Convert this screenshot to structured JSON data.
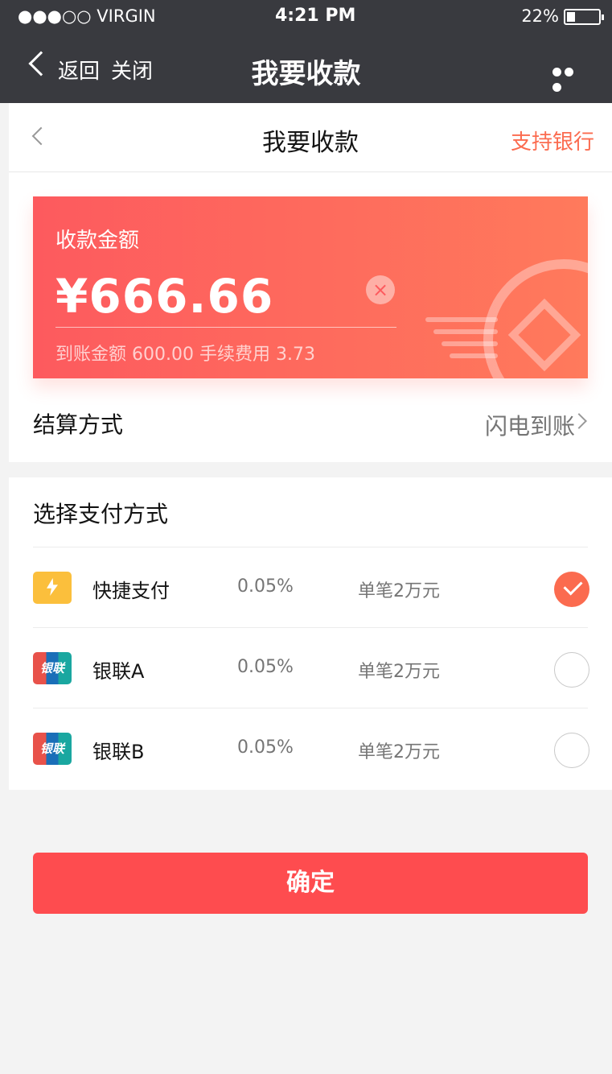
{
  "status_bar": {
    "carrier": "●●●○○ VIRGIN",
    "time": "4:21 PM",
    "battery": "22%"
  },
  "wechat_bar": {
    "back_label": "返回",
    "close_label": "关闭",
    "title": "我要收款"
  },
  "header": {
    "title": "我要收款",
    "right_link": "支持银行"
  },
  "amount_card": {
    "label": "收款金额",
    "amount": "¥666.66",
    "received_text": "到账金额 600.00 手续费用 3.73",
    "clear_icon": "×"
  },
  "settlement": {
    "label": "结算方式",
    "value": "闪电到账"
  },
  "payment": {
    "title": "选择支付方式",
    "methods": [
      {
        "name": "快捷支付",
        "fee": "0.05%",
        "limit": "单笔2万元",
        "icon": "flash-card-icon",
        "selected": true
      },
      {
        "name": "银联A",
        "fee": "0.05%",
        "limit": "单笔2万元",
        "icon": "unionpay-icon",
        "icon_text": "银联",
        "selected": false
      },
      {
        "name": "银联B",
        "fee": "0.05%",
        "limit": "单笔2万元",
        "icon": "unionpay-icon",
        "icon_text": "银联",
        "selected": false
      }
    ]
  },
  "confirm_button": {
    "label": "确定"
  },
  "colors": {
    "accent": "#fb6b4f",
    "button": "#fe4c4f",
    "text": "#141414",
    "muted": "#757575",
    "background": "#f3f3f3"
  }
}
